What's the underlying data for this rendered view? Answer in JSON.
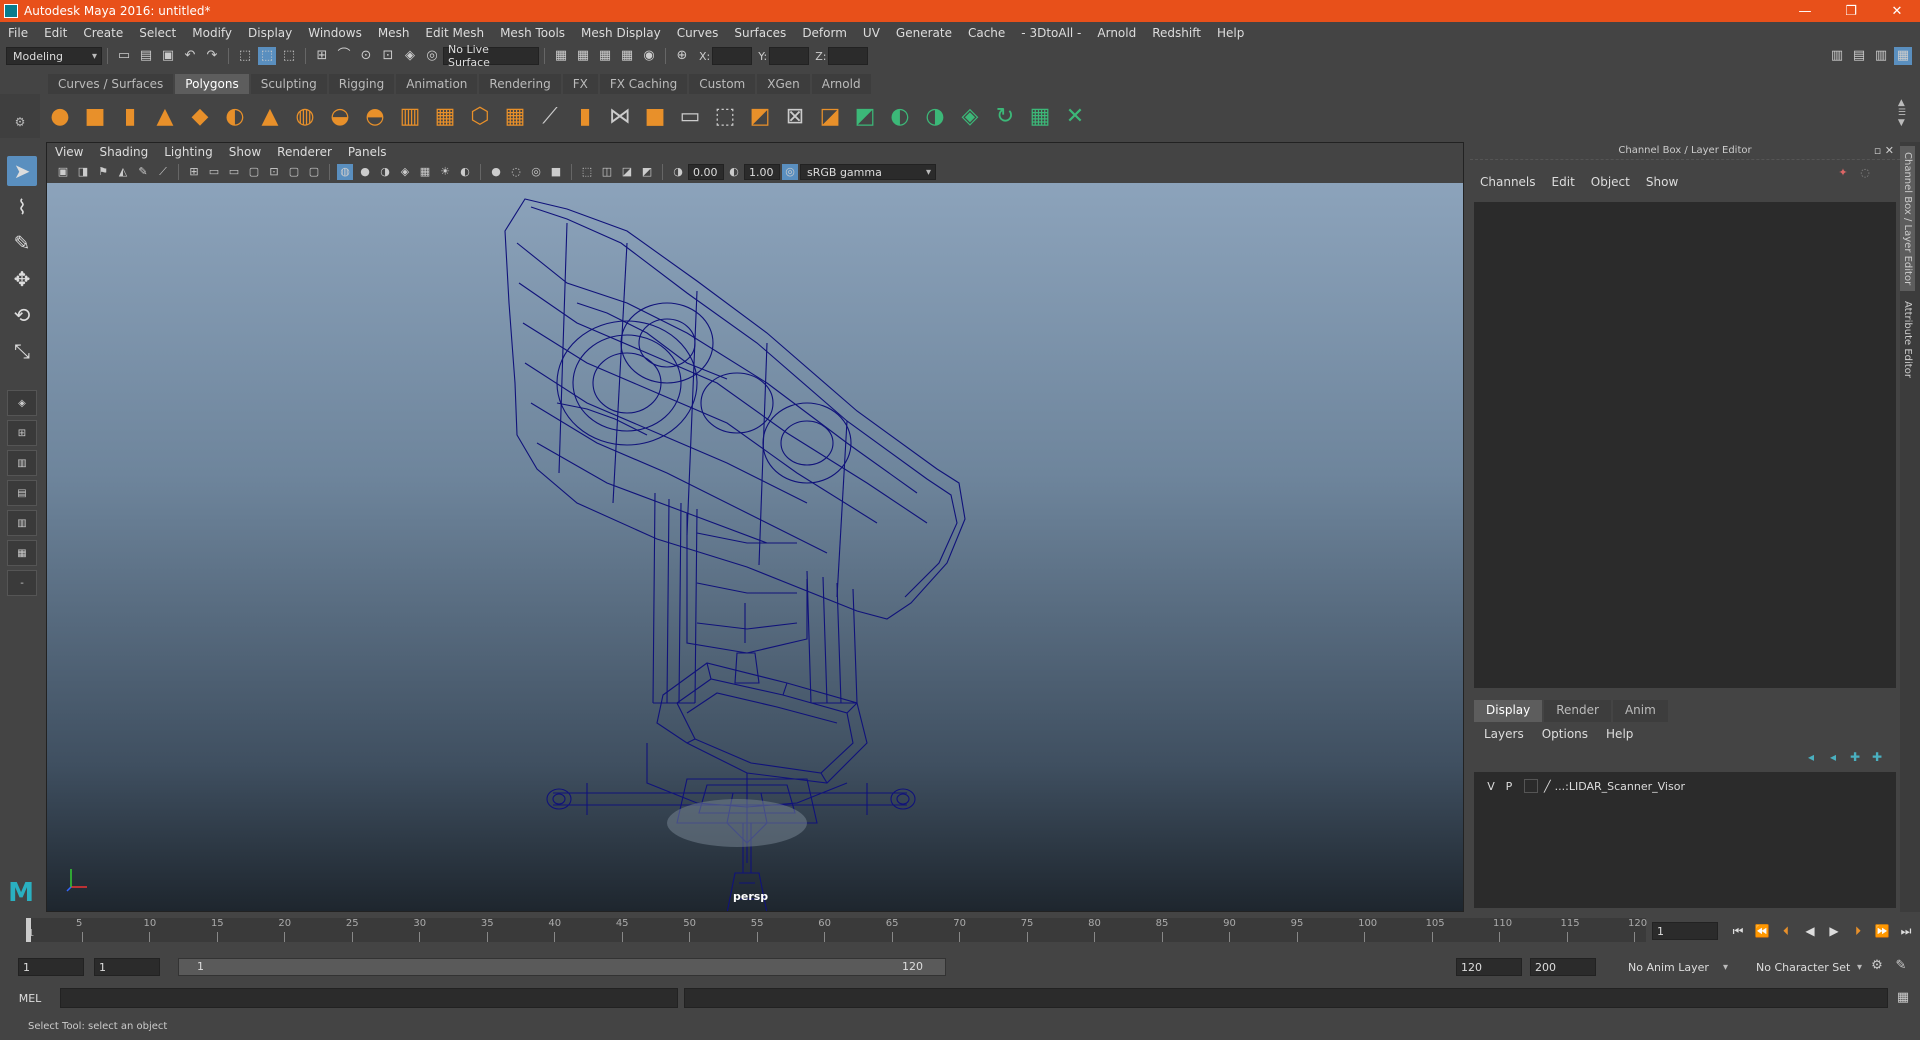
{
  "window": {
    "title": "Autodesk Maya 2016: untitled*",
    "controls": [
      "—",
      "❐",
      "✕"
    ]
  },
  "menubar": [
    "File",
    "Edit",
    "Create",
    "Select",
    "Modify",
    "Display",
    "Windows",
    "Mesh",
    "Edit Mesh",
    "Mesh Tools",
    "Mesh Display",
    "Curves",
    "Surfaces",
    "Deform",
    "UV",
    "Generate",
    "Cache",
    "- 3DtoAll -",
    "Arnold",
    "Redshift",
    "Help"
  ],
  "statusline": {
    "menuset": "Modeling",
    "live_surface": "No Live Surface",
    "x_label": "X:",
    "y_label": "Y:",
    "z_label": "Z:"
  },
  "shelf": {
    "tabs": [
      "Curves / Surfaces",
      "Polygons",
      "Sculpting",
      "Rigging",
      "Animation",
      "Rendering",
      "FX",
      "FX Caching",
      "Custom",
      "XGen",
      "Arnold"
    ],
    "active_tab": "Polygons"
  },
  "viewport": {
    "menu": [
      "View",
      "Shading",
      "Lighting",
      "Show",
      "Renderer",
      "Panels"
    ],
    "exposure": "0.00",
    "gamma": "1.00",
    "color_space": "sRGB gamma",
    "camera": "persp",
    "wire_color": "#10127a"
  },
  "channel_box": {
    "header": "Channel Box / Layer Editor",
    "menu": [
      "Channels",
      "Edit",
      "Object",
      "Show"
    ],
    "layer_tabs": [
      "Display",
      "Render",
      "Anim"
    ],
    "active_layer_tab": "Display",
    "layer_menu": [
      "Layers",
      "Options",
      "Help"
    ],
    "layers": [
      {
        "v": "V",
        "p": "P",
        "name": "...:LIDAR_Scanner_Visor"
      }
    ]
  },
  "side_tabs": [
    "Channel Box / Layer Editor",
    "Attribute Editor"
  ],
  "timeslider": {
    "ticks": [
      "5",
      "10",
      "15",
      "20",
      "25",
      "30",
      "35",
      "40",
      "45",
      "50",
      "55",
      "60",
      "65",
      "70",
      "75",
      "80",
      "85",
      "90",
      "95",
      "100",
      "105",
      "110",
      "115",
      "120"
    ],
    "current_frame": "1",
    "first_tick": "1"
  },
  "range": {
    "start": "1",
    "anim_start": "1",
    "range_start": "1",
    "range_end": "120",
    "anim_end": "120",
    "end": "200",
    "anim_layer": "No Anim Layer",
    "char_set": "No Character Set"
  },
  "cmdline": {
    "label": "MEL"
  },
  "helpline": {
    "text": "Select Tool: select an object"
  }
}
